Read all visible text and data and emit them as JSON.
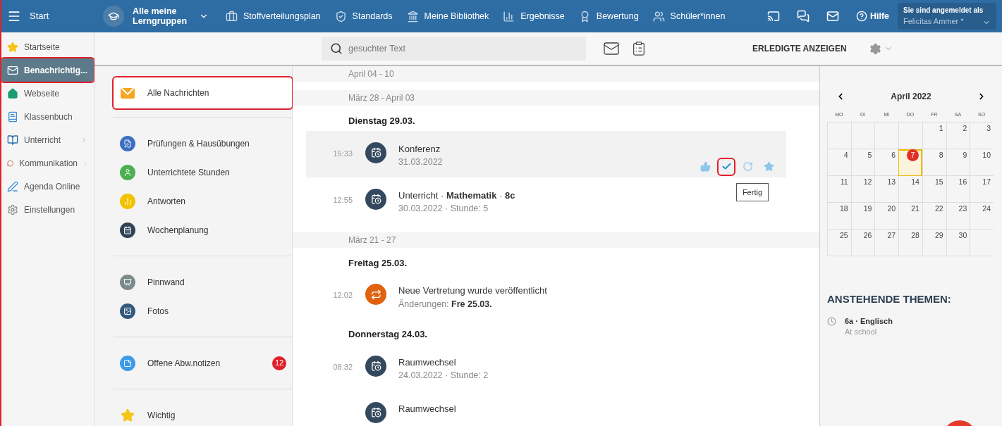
{
  "topbar": {
    "menu_label": "Start",
    "group": "Alle meine Lerngruppen",
    "nav": [
      {
        "label": "Stoffverteilungsplan",
        "kind": "briefcase"
      },
      {
        "label": "Standards",
        "kind": "shield"
      },
      {
        "label": "Meine Bibliothek",
        "kind": "library"
      },
      {
        "label": "Ergebnisse",
        "kind": "chart"
      },
      {
        "label": "Bewertung",
        "kind": "grade"
      },
      {
        "label": "Schüler*innen",
        "kind": "people"
      }
    ],
    "help": "Hilfe",
    "user_caption": "Sie sind angemeldet als",
    "user_name": "Felicitas Ammer *"
  },
  "sidebar": [
    {
      "label": "Startseite",
      "kind": "star",
      "selected": false,
      "annotated": false,
      "has_submenu": false
    },
    {
      "label": "Benachrichtig...",
      "kind": "mail",
      "selected": true,
      "annotated": true,
      "has_submenu": false
    },
    {
      "label": "Webseite",
      "kind": "home",
      "selected": false,
      "annotated": false,
      "has_submenu": false
    },
    {
      "label": "Klassenbuch",
      "kind": "book",
      "selected": false,
      "annotated": false,
      "has_submenu": false
    },
    {
      "label": "Unterricht",
      "kind": "openbook",
      "selected": false,
      "annotated": false,
      "has_submenu": true
    },
    {
      "label": "Kommunikation",
      "kind": "chat",
      "selected": false,
      "annotated": false,
      "has_submenu": true
    },
    {
      "label": "Agenda Online",
      "kind": "pen",
      "selected": false,
      "annotated": false,
      "has_submenu": false
    },
    {
      "label": "Einstellungen",
      "kind": "gear",
      "selected": false,
      "annotated": false,
      "has_submenu": false
    }
  ],
  "toolbar": {
    "search": {
      "placeholder": "gesuchter Text"
    },
    "show_done": "ERLEDIGTE ANZEIGEN"
  },
  "categories": [
    [
      {
        "label": "Alle Nachrichten",
        "kind": "envelope",
        "color": "#f5a623",
        "selected": true,
        "annotated": true
      }
    ],
    [
      {
        "label": "Prüfungen & Hausübungen",
        "kind": "exam",
        "color": "#3b6fc2",
        "selected": false,
        "annotated": false
      },
      {
        "label": "Unterrichtete Stunden",
        "kind": "person",
        "color": "#4caf50",
        "selected": false,
        "annotated": false
      },
      {
        "label": "Antworten",
        "kind": "bars",
        "color": "#f2c200",
        "selected": false,
        "annotated": false
      },
      {
        "label": "Wochenplanung",
        "kind": "calendar",
        "color": "#2f4256",
        "selected": false,
        "annotated": false
      }
    ],
    [
      {
        "label": "Pinnwand",
        "kind": "board",
        "color": "#7b8a8b",
        "selected": false,
        "annotated": false
      },
      {
        "label": "Fotos",
        "kind": "photo",
        "color": "#34597e",
        "selected": false,
        "annotated": false
      }
    ],
    [
      {
        "label": "Offene Abw.notizen",
        "kind": "note",
        "color": "#3d9be9",
        "selected": false,
        "annotated": false,
        "badge": "12"
      }
    ],
    [
      {
        "label": "Wichtig",
        "kind": "star",
        "color": "#f5c518",
        "selected": false,
        "annotated": false
      }
    ]
  ],
  "feed": [
    {
      "week": "April 04 - 10"
    },
    {
      "week": "März 28 - April 03",
      "days": [
        {
          "day": "Dienstag 29.03.",
          "messages": [
            {
              "time": "15:33",
              "kind": "schedule",
              "title": "Konferenz",
              "subtitle": "31.03.2022",
              "hovered": true,
              "actions": [
                {
                  "kind": "like",
                  "annotated": false
                },
                {
                  "kind": "done",
                  "annotated": true
                },
                {
                  "kind": "undo",
                  "annotated": false
                },
                {
                  "kind": "star",
                  "annotated": false
                }
              ],
              "tooltip": "Fertig"
            },
            {
              "time": "12:55",
              "kind": "schedule",
              "title": "Unterricht · **Mathematik** · **8c**",
              "subtitle": "30.03.2022 · Stunde: 5",
              "hovered": false
            }
          ]
        }
      ]
    },
    {
      "week": "März 21 - 27",
      "days": [
        {
          "day": "Freitag 25.03.",
          "messages": [
            {
              "time": "12:02",
              "kind": "substitution",
              "title": "Neue Vertretung wurde veröffentlicht",
              "subtitle": "Änderungen: **Fre 25.03.**",
              "hovered": false
            }
          ]
        },
        {
          "day": "Donnerstag 24.03.",
          "messages": [
            {
              "time": "08:32",
              "kind": "schedule",
              "title": "Raumwechsel",
              "subtitle": "24.03.2022 · Stunde: 2",
              "hovered": false
            },
            {
              "kind": "schedule",
              "title": "Raumwechsel",
              "hovered": false
            }
          ]
        }
      ]
    }
  ],
  "calendar": {
    "month": "April 2022",
    "weekdays": [
      "MO",
      "DI",
      "MI",
      "DO",
      "FR",
      "SA",
      "SO"
    ],
    "weeks": [
      [
        {
          "kind": "blank"
        },
        {
          "kind": "blank"
        },
        {
          "kind": "blank"
        },
        {
          "kind": "blank"
        },
        {
          "kind": "day",
          "day": "1",
          "selected": false
        },
        {
          "kind": "day",
          "day": "2",
          "selected": false
        },
        {
          "kind": "day",
          "day": "3",
          "selected": false
        }
      ],
      [
        {
          "kind": "day",
          "day": "4",
          "selected": false
        },
        {
          "kind": "day",
          "day": "5",
          "selected": false
        },
        {
          "kind": "day",
          "day": "6",
          "selected": false
        },
        {
          "kind": "day",
          "day": "7",
          "selected": true
        },
        {
          "kind": "day",
          "day": "8",
          "selected": false
        },
        {
          "kind": "day",
          "day": "9",
          "selected": false
        },
        {
          "kind": "day",
          "day": "10",
          "selected": false
        }
      ],
      [
        {
          "kind": "day",
          "day": "11",
          "selected": false
        },
        {
          "kind": "day",
          "day": "12",
          "selected": false
        },
        {
          "kind": "day",
          "day": "13",
          "selected": false
        },
        {
          "kind": "day",
          "day": "14",
          "selected": false
        },
        {
          "kind": "day",
          "day": "15",
          "selected": false
        },
        {
          "kind": "day",
          "day": "16",
          "selected": false
        },
        {
          "kind": "day",
          "day": "17",
          "selected": false
        }
      ],
      [
        {
          "kind": "day",
          "day": "18",
          "selected": false
        },
        {
          "kind": "day",
          "day": "19",
          "selected": false
        },
        {
          "kind": "day",
          "day": "20",
          "selected": false
        },
        {
          "kind": "day",
          "day": "21",
          "selected": false
        },
        {
          "kind": "day",
          "day": "22",
          "selected": false
        },
        {
          "kind": "day",
          "day": "23",
          "selected": false
        },
        {
          "kind": "day",
          "day": "24",
          "selected": false
        }
      ],
      [
        {
          "kind": "day",
          "day": "25",
          "selected": false
        },
        {
          "kind": "day",
          "day": "26",
          "selected": false
        },
        {
          "kind": "day",
          "day": "27",
          "selected": false
        },
        {
          "kind": "day",
          "day": "28",
          "selected": false
        },
        {
          "kind": "day",
          "day": "29",
          "selected": false
        },
        {
          "kind": "day",
          "day": "30",
          "selected": false
        },
        {
          "kind": "blank"
        }
      ]
    ]
  },
  "topics": {
    "title": "ANSTEHENDE THEMEN:",
    "items": [
      {
        "title": "6a · Englisch",
        "subtitle": "At school"
      }
    ]
  }
}
